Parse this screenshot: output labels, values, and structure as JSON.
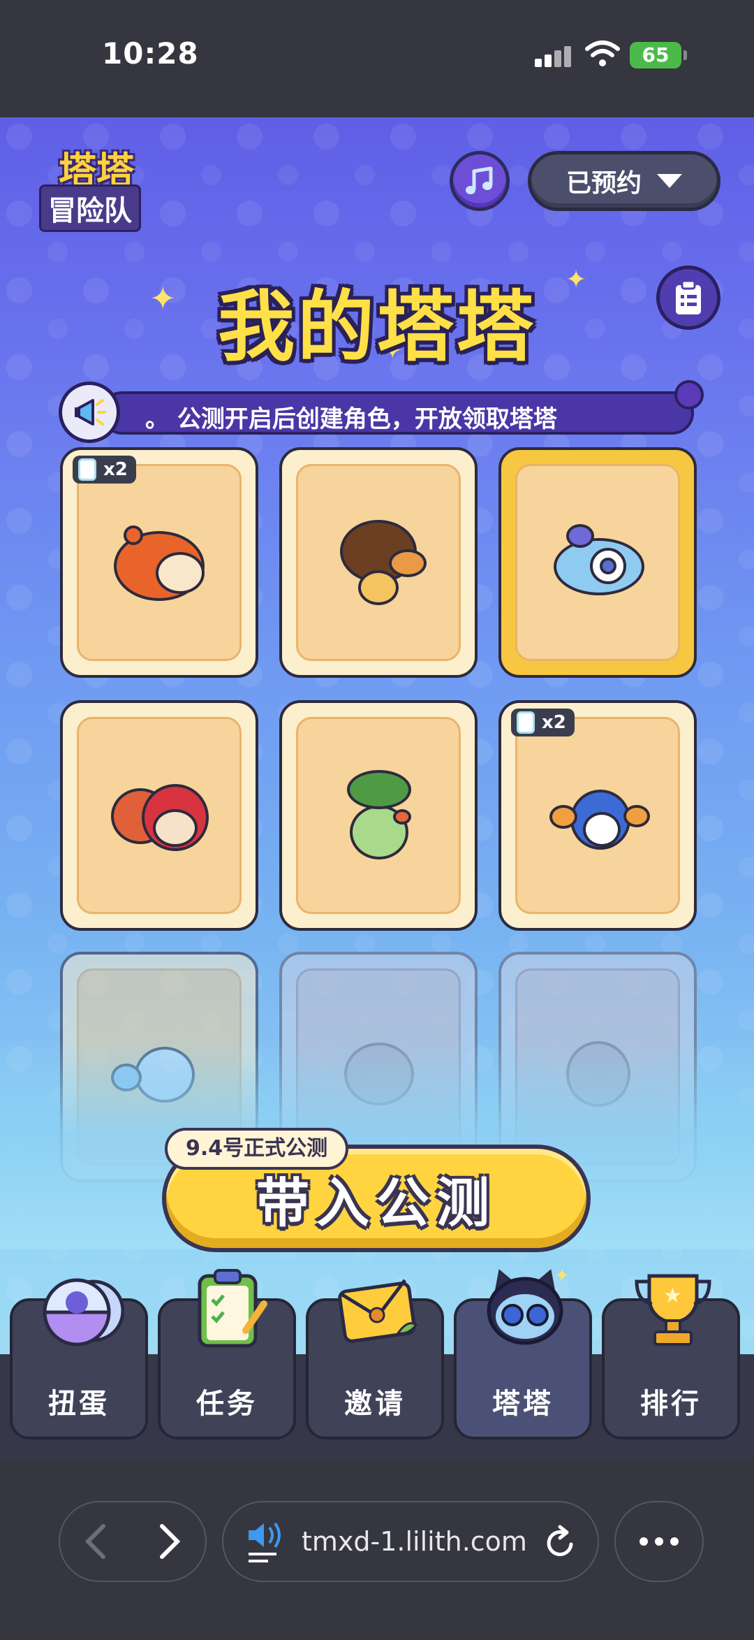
{
  "status_bar": {
    "time": "10:28",
    "battery": "65"
  },
  "header": {
    "logo_line1": "塔塔",
    "logo_line2": "冒险队",
    "reserve_label": "已预约",
    "title": "我的塔塔"
  },
  "marquee": {
    "text": "。   公测开启后创建角色，开放领取塔塔"
  },
  "cards": [
    {
      "badge": "x2",
      "creature": "tiger-creature",
      "state": "owned"
    },
    {
      "badge": "",
      "creature": "snail-creature",
      "state": "owned"
    },
    {
      "badge": "",
      "creature": "blue-dragon-creature",
      "state": "selected"
    },
    {
      "badge": "",
      "creature": "red-seal-creature",
      "state": "owned"
    },
    {
      "badge": "",
      "creature": "leaf-creature",
      "state": "owned"
    },
    {
      "badge": "x2",
      "creature": "bird-creature",
      "state": "owned"
    },
    {
      "badge": "",
      "creature": "axolotl-creature",
      "state": "faded"
    },
    {
      "badge": "",
      "creature": "hamster-creature",
      "state": "locked"
    },
    {
      "badge": "",
      "creature": "duck-creature",
      "state": "locked"
    }
  ],
  "cta": {
    "tag": "9.4号正式公测",
    "label": "带入公测"
  },
  "bottom_nav": [
    {
      "label": "扭蛋",
      "icon": "gacha-egg-icon"
    },
    {
      "label": "任务",
      "icon": "clipboard-task-icon"
    },
    {
      "label": "邀请",
      "icon": "envelope-icon"
    },
    {
      "label": "塔塔",
      "icon": "tata-mascot-icon"
    },
    {
      "label": "排行",
      "icon": "trophy-icon"
    }
  ],
  "browser": {
    "url": "tmxd-1.lilith.com"
  },
  "colors": {
    "accent_yellow": "#ffd440",
    "outline": "#2d2a3d",
    "purple": "#4b36a6"
  }
}
